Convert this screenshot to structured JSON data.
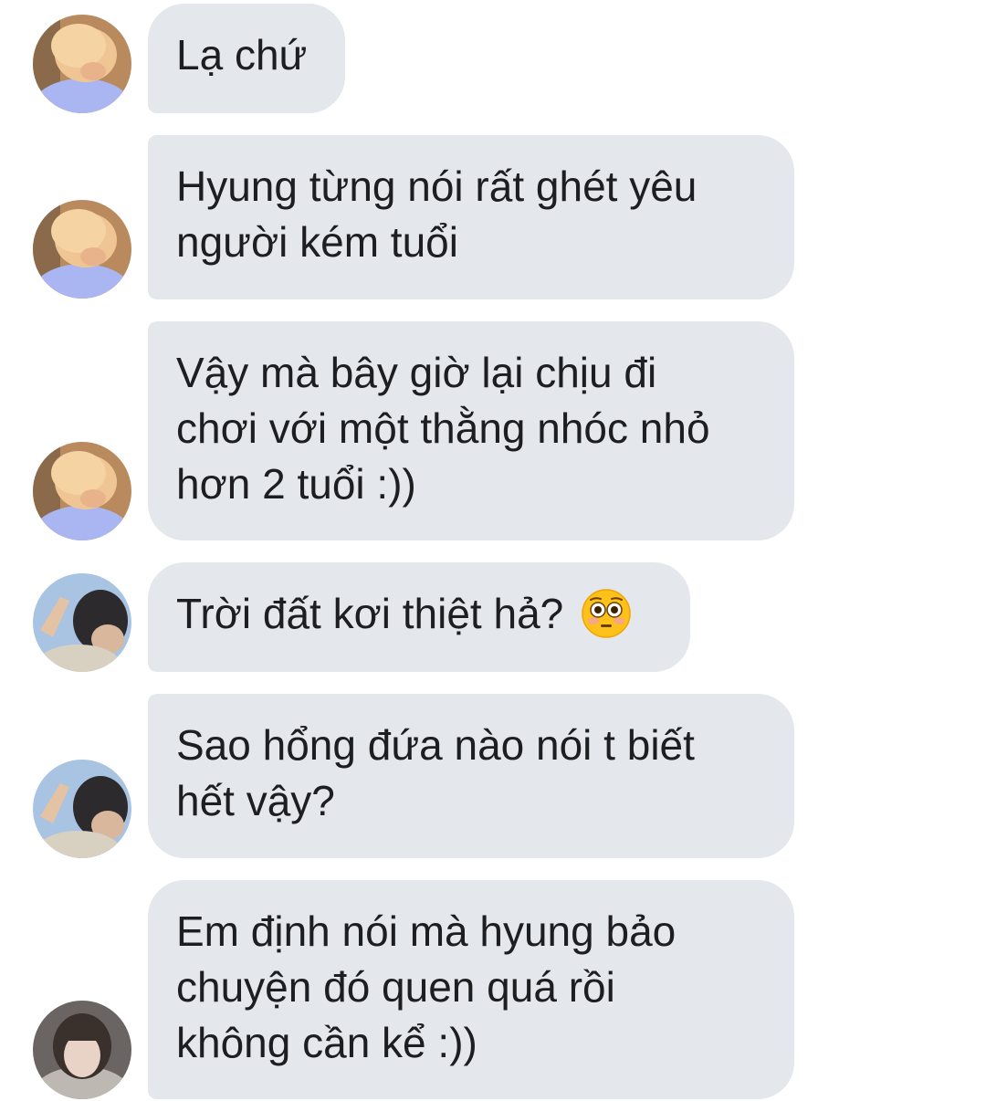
{
  "messages": [
    {
      "sender": "contact-a",
      "text": "Lạ chứ"
    },
    {
      "sender": "contact-a",
      "text": "Hyung từng nói rất ghét yêu\nngười kém tuổi"
    },
    {
      "sender": "contact-a",
      "text": "Vậy mà bây giờ lại chịu đi\nchơi với một thằng nhóc nhỏ\nhơn 2 tuổi :))"
    },
    {
      "sender": "contact-b",
      "text": "Trời đất kơi thiệt hả?",
      "emoji": "flushed-face-icon"
    },
    {
      "sender": "contact-b",
      "text": "Sao hổng đứa nào nói t biết\nhết vậy?"
    },
    {
      "sender": "contact-c",
      "text": "Em định nói mà hyung bảo\nchuyện đó quen quá rồi\nkhông cần kể :))"
    }
  ],
  "colors": {
    "bubble_bg": "#e4e7eb",
    "text": "#1c1e21",
    "background": "#ffffff"
  }
}
